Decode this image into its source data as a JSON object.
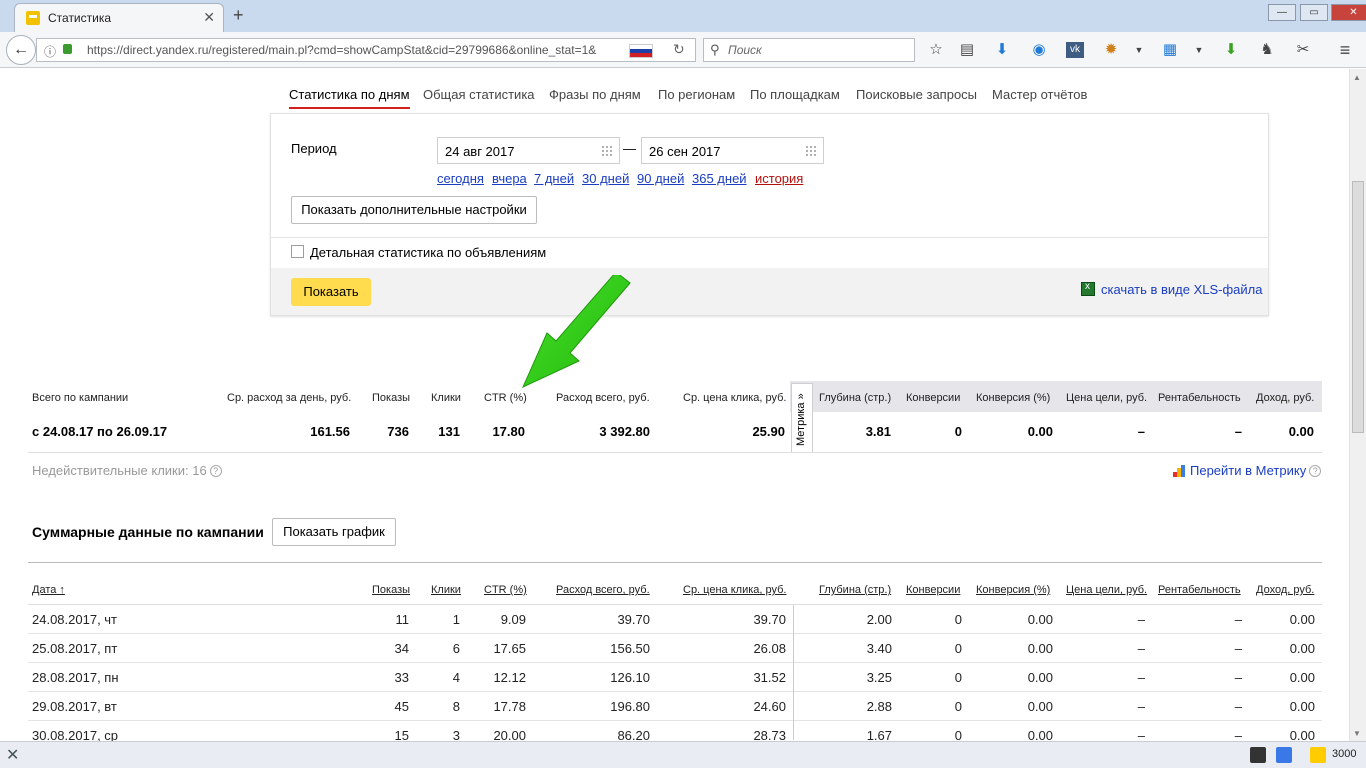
{
  "browser": {
    "tab_title": "Статистика",
    "tab_close": "✕",
    "newtab": "+",
    "win_min": "—",
    "win_max": "▭",
    "win_close": "✕",
    "back": "←",
    "info": "ⓘ",
    "url": "https://direct.yandex.ru/registered/main.pl?cmd=showCampStat&cid=29799686&online_stat=1&",
    "reload": "↻",
    "search_icon": "🔍",
    "search_placeholder": "Поиск",
    "toolbar_icons": [
      "star-icon",
      "reader-icon",
      "download-icon",
      "odnoklassniki-icon",
      "vk-icon",
      "bug-icon",
      "menu-arrow-icon",
      "grid-icon",
      "dropdown-icon",
      "green-download-icon",
      "evernote-icon",
      "tools-icon",
      "hamburger-icon"
    ]
  },
  "page": {
    "tabs": [
      "Статистика по дням",
      "Общая статистика",
      "Фразы по дням",
      "По регионам",
      "По площадкам",
      "Поисковые запросы",
      "Мастер отчётов"
    ],
    "filter": {
      "period_label": "Период",
      "date_from": "24 авг 2017",
      "date_to": "26 сен 2017",
      "dash": "—",
      "quick_links": [
        "сегодня",
        "вчера",
        "7 дней",
        "30 дней",
        "90 дней",
        "365 дней"
      ],
      "history_link": "история",
      "extra_settings_btn": "Показать дополнительные настройки",
      "detail_checkbox": "Детальная статистика по объявлениям",
      "show_btn": "Показать",
      "xls_link": "скачать в виде XLS-файла"
    },
    "summary": {
      "headers": [
        "Всего по кампании",
        "Ср. расход за день, руб.",
        "Показы",
        "Клики",
        "CTR (%)",
        "Расход всего, руб.",
        "Ср. цена клика, руб.",
        "Глубина (стр.)",
        "Конверсии",
        "Конверсия (%)",
        "Цена цели, руб.",
        "Рентабельность",
        "Доход, руб."
      ],
      "values": [
        "с 24.08.17 по 26.09.17",
        "161.56",
        "736",
        "131",
        "17.80",
        "3 392.80",
        "25.90",
        "3.81",
        "0",
        "0.00",
        "–",
        "–",
        "0.00"
      ],
      "metrika_tab": "Метрика »",
      "invalid_clicks": "Недействительные клики: 16",
      "help": "?",
      "metrika_link": "Перейти в Метрику"
    },
    "summary_section": {
      "title": "Суммарные данные по кампании",
      "chart_btn": "Показать график"
    },
    "daily": {
      "headers": [
        "Дата ↑",
        "Показы",
        "Клики",
        "CTR (%)",
        "Расход всего, руб.",
        "Ср. цена клика, руб.",
        "Глубина (стр.)",
        "Конверсии",
        "Конверсия (%)",
        "Цена цели, руб.",
        "Рентабельность",
        "Доход, руб."
      ],
      "rows": [
        [
          "24.08.2017, чт",
          "11",
          "1",
          "9.09",
          "39.70",
          "39.70",
          "2.00",
          "0",
          "0.00",
          "–",
          "–",
          "0.00"
        ],
        [
          "25.08.2017, пт",
          "34",
          "6",
          "17.65",
          "156.50",
          "26.08",
          "3.40",
          "0",
          "0.00",
          "–",
          "–",
          "0.00"
        ],
        [
          "28.08.2017, пн",
          "33",
          "4",
          "12.12",
          "126.10",
          "31.52",
          "3.25",
          "0",
          "0.00",
          "–",
          "–",
          "0.00"
        ],
        [
          "29.08.2017, вт",
          "45",
          "8",
          "17.78",
          "196.80",
          "24.60",
          "2.88",
          "0",
          "0.00",
          "–",
          "–",
          "0.00"
        ],
        [
          "30.08.2017, ср",
          "15",
          "3",
          "20.00",
          "86.20",
          "28.73",
          "1.67",
          "0",
          "0.00",
          "–",
          "–",
          "0.00"
        ]
      ]
    }
  },
  "statusbar": {
    "close": "✕",
    "counter": "3000"
  },
  "colors": {
    "accent_red": "#d0201a",
    "link_blue": "#1a3dc1",
    "button_yellow": "#ffdb4d",
    "arrow_green": "#2ec414"
  }
}
